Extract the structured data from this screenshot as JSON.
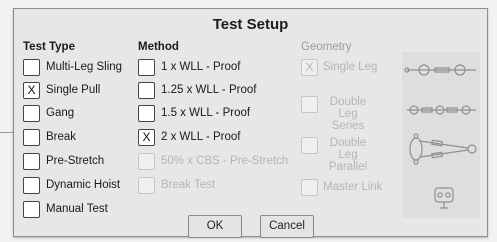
{
  "dialog": {
    "title": "Test Setup"
  },
  "test_type": {
    "heading": "Test Type",
    "options": [
      {
        "label": "Multi-Leg Sling",
        "checked": false
      },
      {
        "label": "Single Pull",
        "checked": true
      },
      {
        "label": "Gang",
        "checked": false
      },
      {
        "label": "Break",
        "checked": false
      },
      {
        "label": "Pre-Stretch",
        "checked": false
      },
      {
        "label": "Dynamic Hoist",
        "checked": false
      },
      {
        "label": "Manual Test",
        "checked": false
      }
    ]
  },
  "method": {
    "heading": "Method",
    "options": [
      {
        "label": "1 x WLL - Proof",
        "checked": false,
        "enabled": true
      },
      {
        "label": "1.25 x WLL - Proof",
        "checked": false,
        "enabled": true
      },
      {
        "label": "1.5 x WLL - Proof",
        "checked": false,
        "enabled": true
      },
      {
        "label": "2 x WLL - Proof",
        "checked": true,
        "enabled": true
      },
      {
        "label": "50% x CBS - Pre-Stretch",
        "checked": false,
        "enabled": false
      },
      {
        "label": "Break Test",
        "checked": false,
        "enabled": false
      }
    ]
  },
  "geometry": {
    "heading": "Geometry",
    "options": [
      {
        "label": "Single Leg",
        "checked": true,
        "enabled": false
      },
      {
        "label": "Double Leg Series",
        "checked": false,
        "enabled": false
      },
      {
        "label": "Double Leg Parallel",
        "checked": false,
        "enabled": false
      },
      {
        "label": "Master Link",
        "checked": false,
        "enabled": false
      }
    ]
  },
  "check_mark": "X",
  "buttons": {
    "ok": "OK",
    "cancel": "Cancel"
  }
}
